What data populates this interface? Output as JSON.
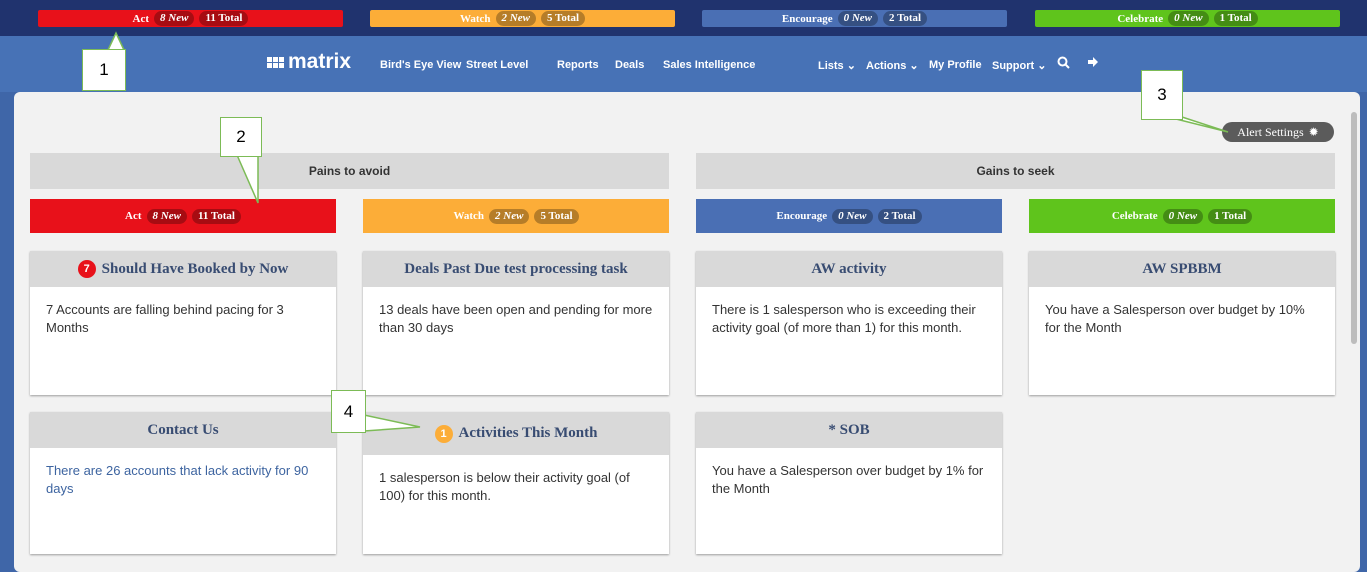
{
  "categories": {
    "act": {
      "label": "Act",
      "new": "8 New",
      "total": "11 Total",
      "color": "#e8111a"
    },
    "watch": {
      "label": "Watch",
      "new": "2 New",
      "total": "5 Total",
      "color": "#fcad38"
    },
    "encourage": {
      "label": "Encourage",
      "new": "0 New",
      "total": "2 Total",
      "color": "#4a6fb4"
    },
    "celebrate": {
      "label": "Celebrate",
      "new": "0 New",
      "total": "1 Total",
      "color": "#5fc41c"
    }
  },
  "nav": {
    "logo": "matrix",
    "items": [
      "Bird's Eye View",
      "Street Level",
      "Reports",
      "Deals",
      "Sales Intelligence"
    ],
    "right_items": [
      "Lists",
      "Actions",
      "My Profile",
      "Support"
    ]
  },
  "alert_settings_label": "Alert Settings",
  "sections": {
    "pains": "Pains to avoid",
    "gains": "Gains to seek"
  },
  "cards": [
    {
      "title": "Should Have Booked by Now",
      "count": "7",
      "count_color": "#e8111a",
      "body": "7 Accounts are falling behind pacing for 3 Months"
    },
    {
      "title": "Deals Past Due test processing task",
      "body": "13 deals have been open and pending for more than 30 days"
    },
    {
      "title": "AW activity",
      "body": "There is 1 salesperson who is exceeding their activity goal (of more than 1) for this month."
    },
    {
      "title": "AW SPBBM",
      "body": "You have a Salesperson over budget by 10% for the Month"
    },
    {
      "title": "Contact Us",
      "body": "There are 26 accounts that lack activity for 90 days"
    },
    {
      "title": "Activities This Month",
      "count": "1",
      "count_color": "#fcad38",
      "body": "1 salesperson is below their activity goal (of 100) for this month."
    },
    {
      "title": "* SOB",
      "body": "You have a Salesperson over budget by 1% for the Month"
    }
  ],
  "callouts": [
    "1",
    "2",
    "3",
    "4"
  ]
}
